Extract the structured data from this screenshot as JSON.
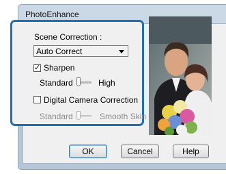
{
  "window": {
    "title": "PhotoEnhance"
  },
  "scene_correction": {
    "label": "Scene Correction :",
    "selected": "Auto Correct"
  },
  "sharpen": {
    "label": "Sharpen",
    "checked": true,
    "slider_min_label": "Standard",
    "slider_max_label": "High",
    "slider_level": 0.0
  },
  "digital_camera_correction": {
    "label": "Digital Camera Correction",
    "checked": false,
    "slider_min_label": "Standard",
    "slider_max_label": "Smooth Skin",
    "slider_level": 0.0,
    "disabled": true
  },
  "buttons": {
    "ok": "OK",
    "cancel": "Cancel",
    "help": "Help"
  },
  "colors": {
    "highlight_border": "#1f6fb1",
    "title_bar": "#cbd8e6",
    "dialog_background": "#f0f0f0"
  },
  "preview": {
    "icon": "preview-photo-couple-with-flowers"
  }
}
